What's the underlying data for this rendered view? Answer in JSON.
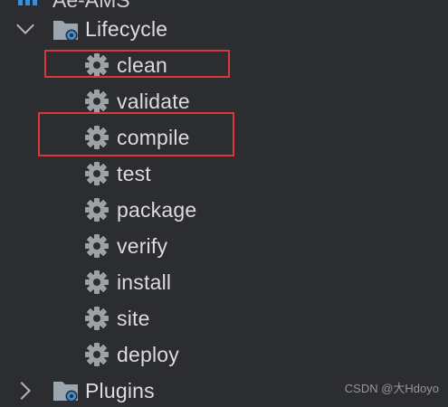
{
  "tree": {
    "partial_top_item": "Ae-AMS",
    "lifecycle": {
      "label": "Lifecycle",
      "expanded": true
    },
    "goals": [
      {
        "label": "clean",
        "highlighted": true
      },
      {
        "label": "validate",
        "highlighted": false
      },
      {
        "label": "compile",
        "highlighted": true
      },
      {
        "label": "test",
        "highlighted": false
      },
      {
        "label": "package",
        "highlighted": false
      },
      {
        "label": "verify",
        "highlighted": false
      },
      {
        "label": "install",
        "highlighted": false
      },
      {
        "label": "site",
        "highlighted": false
      },
      {
        "label": "deploy",
        "highlighted": false
      }
    ],
    "plugins": {
      "label": "Plugins",
      "expanded": false
    }
  },
  "watermark": "CSDN @大Hdoyo",
  "colors": {
    "background": "#2b2d30",
    "text": "#dcdcdc",
    "gear": "#9da0a4",
    "folder": "#9aa7b0",
    "folder_badge": "#3b8fd9",
    "highlight_box": "#d9363e"
  }
}
